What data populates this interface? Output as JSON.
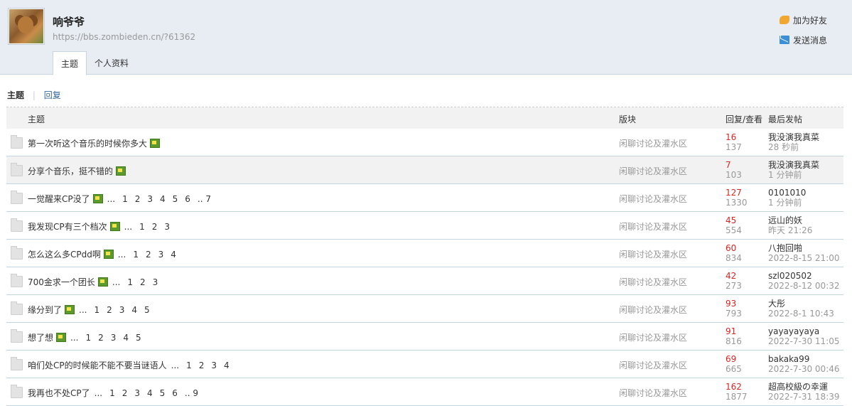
{
  "profile": {
    "name": "响爷爷",
    "url": "https://bbs.zombieden.cn/?61362",
    "add_friend": "加为好友",
    "send_message": "发送消息"
  },
  "tabs": [
    {
      "label": "主题"
    },
    {
      "label": "个人资料"
    }
  ],
  "subnav": {
    "current": "主题",
    "other": "回复"
  },
  "table": {
    "headers": {
      "subject": "主题",
      "forum": "版块",
      "stats": "回复/查看",
      "last": "最后发帖"
    },
    "rows": [
      {
        "title": "第一次听这个音乐的时候你多大",
        "pages": [],
        "forum": "闲聊讨论及灌水区",
        "replies": "16",
        "views": "137",
        "last_user": "我没演我真菜",
        "last_time": "28 秒前"
      },
      {
        "title": "分享个音乐，挺不错的",
        "pages": [],
        "forum": "闲聊讨论及灌水区",
        "replies": "7",
        "views": "103",
        "last_user": "我没演我真菜",
        "last_time": "1 分钟前"
      },
      {
        "title": "一觉醒来CP没了",
        "pages": [
          "1",
          "2",
          "3",
          "4",
          "5",
          "6",
          ".. 7"
        ],
        "forum": "闲聊讨论及灌水区",
        "replies": "127",
        "views": "1330",
        "last_user": "0101010",
        "last_time": "1 分钟前"
      },
      {
        "title": "我发现CP有三个档次",
        "pages": [
          "1",
          "2",
          "3"
        ],
        "forum": "闲聊讨论及灌水区",
        "replies": "45",
        "views": "554",
        "last_user": "远山的妖",
        "last_time": "昨天 21:26"
      },
      {
        "title": "怎么这么多CPdd啊",
        "pages": [
          "1",
          "2",
          "3",
          "4"
        ],
        "forum": "闲聊讨论及灌水区",
        "replies": "60",
        "views": "834",
        "last_user": "八抱回啪",
        "last_time": "2022-8-15 21:00"
      },
      {
        "title": "700金求一个团长",
        "pages": [
          "1",
          "2",
          "3"
        ],
        "forum": "闲聊讨论及灌水区",
        "replies": "42",
        "views": "273",
        "last_user": "szl020502",
        "last_time": "2022-8-12 00:32"
      },
      {
        "title": "缘分到了",
        "pages": [
          "1",
          "2",
          "3",
          "4",
          "5"
        ],
        "forum": "闲聊讨论及灌水区",
        "replies": "93",
        "views": "793",
        "last_user": "大彤",
        "last_time": "2022-8-1 10:43"
      },
      {
        "title": "想了想",
        "pages": [
          "1",
          "2",
          "3",
          "4",
          "5"
        ],
        "forum": "闲聊讨论及灌水区",
        "replies": "91",
        "views": "816",
        "last_user": "yayayayaya",
        "last_time": "2022-7-30 11:05"
      },
      {
        "title": "咱们处CP的时候能不能不要当谜语人",
        "pages": [
          "1",
          "2",
          "3",
          "4"
        ],
        "forum": "闲聊讨论及灌水区",
        "replies": "69",
        "views": "665",
        "last_user": "bakaka99",
        "last_time": "2022-7-30 00:46"
      },
      {
        "title": "我再也不处CP了",
        "pages": [
          "1",
          "2",
          "3",
          "4",
          "5",
          "6",
          ".. 9"
        ],
        "forum": "闲聊讨论及灌水区",
        "replies": "162",
        "views": "1877",
        "last_user": "超高校級の幸運",
        "last_time": "2022-7-31 18:39"
      }
    ],
    "image_icon_rows": [
      0,
      1,
      2,
      3,
      4,
      5,
      6,
      7
    ],
    "alt_row": 1
  },
  "colors": {
    "header_bg": "#e8edf3",
    "reply_count": "#dd2222",
    "link": "#336699"
  }
}
